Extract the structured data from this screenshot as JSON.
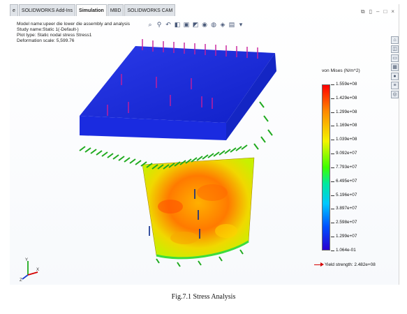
{
  "tabs": [
    {
      "label": "e"
    },
    {
      "label": "SOLIDWORKS Add-Ins"
    },
    {
      "label": "Simulation",
      "active": true
    },
    {
      "label": "MBD"
    },
    {
      "label": "SOLIDWORKS CAM"
    }
  ],
  "info": {
    "model_name": "Model name:upeer die lower die assembly and analysis",
    "study_name": "Study name:Static 1(-Default-)",
    "plot_type": "Plot type: Static nodal stress Stress1",
    "deformation_scale": "Deformation scale: 5,599.76"
  },
  "view_toolbar_icons": [
    "zoom-fit-icon",
    "zoom-area-icon",
    "previous-view-icon",
    "section-view-icon",
    "view-orientation-icon",
    "display-style-icon",
    "hide-show-icon",
    "edit-appearance-icon",
    "scene-icon",
    "view-settings-icon",
    "display-pane-icon"
  ],
  "window_controls": [
    "restore-icon",
    "tile-icon",
    "minimize-icon",
    "maximize-icon",
    "close-icon"
  ],
  "side_dock_icons": [
    "home-icon",
    "design-library-icon",
    "file-explorer-icon",
    "view-palette-icon",
    "appearances-icon",
    "custom-properties-icon",
    "forum-icon"
  ],
  "legend": {
    "title": "von Mises (N/m^2)",
    "ticks": [
      "1.559e+08",
      "1.429e+08",
      "1.299e+08",
      "1.169e+08",
      "1.039e+08",
      "9.092e+07",
      "7.793e+07",
      "6.495e+07",
      "5.196e+07",
      "3.897e+07",
      "2.598e+07",
      "1.299e+07",
      "1.064e-01"
    ],
    "yield_label": "Yield strength: 2.482e+08",
    "yield_color": "#d40000"
  },
  "triad": {
    "y": "Y",
    "x": "X",
    "z": "Z"
  },
  "caption": "Fig.7.1 Stress Analysis",
  "colors": {
    "top_die": "#1c2bd6",
    "lower_die_hot": "#ff8a00",
    "lower_die_mid": "#f4e600",
    "fixture": "#1faa1f",
    "load_arrow": "#c81e9a"
  }
}
